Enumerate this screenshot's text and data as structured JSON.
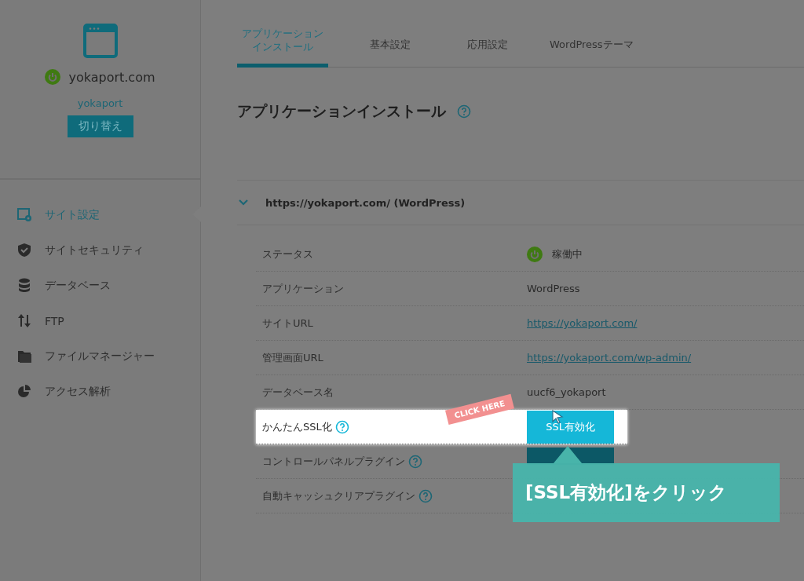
{
  "sidebar": {
    "site": {
      "domain": "yokaport.com",
      "running": true,
      "user": "yokaport",
      "switch_button": "切り替え"
    },
    "items": [
      {
        "label": "サイト設定",
        "selected": true
      },
      {
        "label": "サイトセキュリティ",
        "selected": false
      },
      {
        "label": "データベース",
        "selected": false
      },
      {
        "label": "FTP",
        "selected": false
      },
      {
        "label": "ファイルマネージャー",
        "selected": false
      },
      {
        "label": "アクセス解析",
        "selected": false
      }
    ]
  },
  "tabs": [
    {
      "lines": [
        "アプリケーション",
        "インストール"
      ],
      "selected": true
    },
    {
      "lines": [
        "基本設定"
      ],
      "selected": false
    },
    {
      "lines": [
        "応用設定"
      ],
      "selected": false
    },
    {
      "lines": [
        "WordPressテーマ"
      ],
      "selected": false
    }
  ],
  "heading": "アプリケーションインストール",
  "section": {
    "title": "https://yokaport.com/ (WordPress)",
    "expanded": true,
    "rows": [
      {
        "label": "ステータス",
        "kind": "status",
        "value": "稼働中",
        "running": true
      },
      {
        "label": "アプリケーション",
        "kind": "text",
        "value": "WordPress"
      },
      {
        "label": "サイトURL",
        "kind": "link",
        "value": "https://yokaport.com/"
      },
      {
        "label": "管理画面URL",
        "kind": "link",
        "value": "https://yokaport.com/wp-admin/"
      },
      {
        "label": "データベース名",
        "kind": "text",
        "value": "uucf6_yokaport"
      },
      {
        "label": "かんたんSSL化",
        "kind": "button",
        "help": true,
        "highlighted": true,
        "button": "SSL有効化"
      },
      {
        "label": "コントロールパネルプラグイン",
        "kind": "button",
        "help": true,
        "highlighted": false
      },
      {
        "label": "自動キャッシュクリアプラグイン",
        "kind": "covered",
        "help": true,
        "highlighted": false
      }
    ]
  },
  "sticker": "CLICK HERE",
  "callout": "[SSL有効化]をクリック"
}
